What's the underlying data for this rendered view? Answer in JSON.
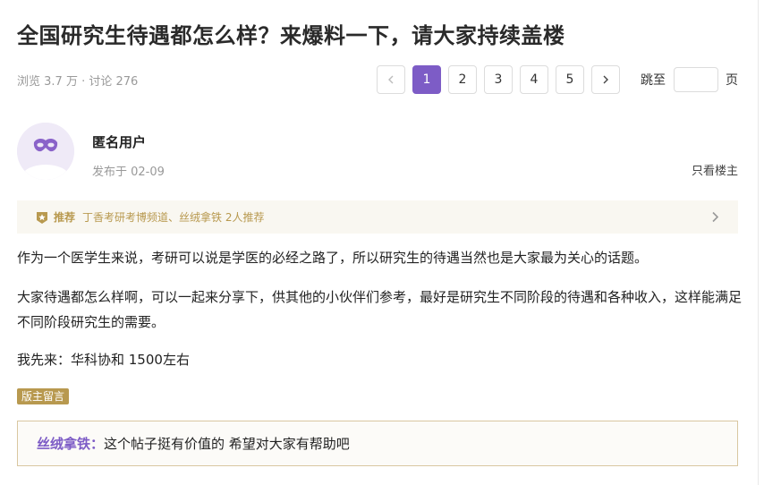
{
  "post": {
    "title": "全国研究生待遇都怎么样？来爆料一下，请大家持续盖楼",
    "stats": "浏览 3.7 万 · 讨论 276"
  },
  "pagination": {
    "prev_icon": "chevron-left-icon",
    "pages": [
      "1",
      "2",
      "3",
      "4",
      "5"
    ],
    "current": "1",
    "next_icon": "chevron-right-icon",
    "jump_label": "跳至",
    "jump_value": "",
    "page_suffix": "页"
  },
  "author": {
    "avatar_icon": "mask-avatar-icon",
    "name": "匿名用户",
    "date": "发布于 02-09",
    "only_op_label": "只看楼主"
  },
  "recommend": {
    "icon": "badge-star-icon",
    "label": "推荐",
    "text": "丁香考研考博频道、丝绒拿铁 2人推荐"
  },
  "body": {
    "p1": "作为一个医学生来说，考研可以说是学医的必经之路了，所以研究生的待遇当然也是大家最为关心的话题。",
    "p2": "大家待遇都怎么样啊，可以一起来分享下，供其他的小伙伴们参考，最好是研究生不同阶段的待遇和各种收入，这样能满足不同阶段研究生的需要。",
    "p3": "我先来：华科协和 1500左右"
  },
  "moderator": {
    "tag": "版主留言",
    "commenter": "丝绒拿铁：",
    "text": "这个帖子挺有价值的 希望对大家有帮助吧"
  },
  "colors": {
    "accent_purple": "#7d5cc6",
    "gold": "#b8994f",
    "recommend_bg": "#f9f7f1"
  }
}
